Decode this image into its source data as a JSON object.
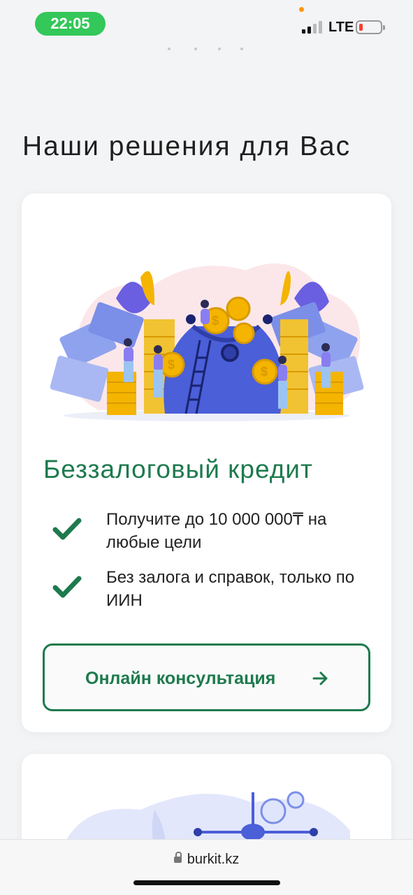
{
  "status_bar": {
    "time": "22:05",
    "network": "LTE",
    "battery_level": 0.1
  },
  "page": {
    "title": "Наши решения для Вас"
  },
  "card": {
    "title": "Беззалоговый кредит",
    "features": [
      "Получите до 10 000 000₸ на любые цели",
      "Без залога и справок, только по ИИН"
    ],
    "cta_label": "Онлайн консультация"
  },
  "browser": {
    "url": "burkit.kz"
  },
  "colors": {
    "accent": "#1e7a4d",
    "status_pill": "#34c759",
    "battery_low": "#ff3b30",
    "illustration_blue": "#4a5fd8",
    "coin_gold": "#f4b400"
  },
  "icons": {
    "feature_bullet": "check-icon",
    "cta": "arrow-right-icon",
    "url": "lock-icon"
  }
}
